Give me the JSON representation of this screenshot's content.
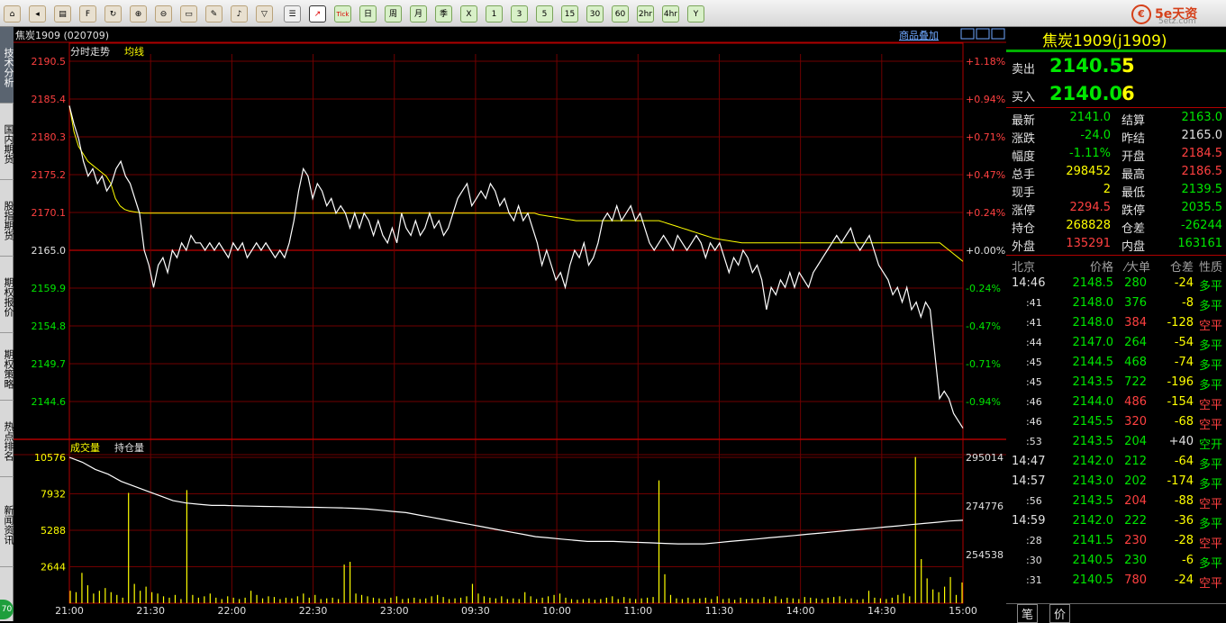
{
  "toolbar": {
    "buttons": [
      "home-icon",
      "back-icon",
      "save-icon",
      "f10",
      "refresh-icon",
      "zoom-in-icon",
      "zoom-out-icon",
      "window-icon",
      "draw-icon",
      "bell-icon",
      "filter-icon",
      "list-icon",
      "intraday-chart-icon",
      "Tick",
      "日",
      "周",
      "月",
      "季",
      "X",
      "1",
      "3",
      "5",
      "15",
      "30",
      "60",
      "2hr",
      "4hr",
      "Y"
    ]
  },
  "logo": {
    "text": "5e天资",
    "sub": "5etz.com"
  },
  "sidebar": {
    "tabs": [
      "技术分析",
      "国内期货",
      "股指期货",
      "期权报价",
      "期权策略",
      "热点排名",
      "新闻资讯"
    ],
    "corner": "70"
  },
  "chart_header": {
    "title": "焦炭1909 (020709)",
    "overlay_link": "商品叠加",
    "tab_intraday": "分时走势",
    "tab_avg": "均线",
    "vol_label": "成交量",
    "oi_label": "持仓量"
  },
  "chart_data": {
    "type": "line",
    "price_axis": {
      "ticks": [
        "2190.5",
        "2185.4",
        "2180.3",
        "2175.2",
        "2170.1",
        "2165.0",
        "2159.9",
        "2154.8",
        "2149.7",
        "2144.6"
      ],
      "pct": [
        "+1.18%",
        "+0.94%",
        "+0.71%",
        "+0.47%",
        "+0.24%",
        "+0.00%",
        "-0.24%",
        "-0.47%",
        "-0.71%",
        "-0.94%"
      ],
      "ylim": [
        2139.5,
        2190.5
      ],
      "prev_settle": 2165.0
    },
    "volume_axis": {
      "left": [
        "10576",
        "7932",
        "5288",
        "2644"
      ],
      "right": [
        "295014",
        "274776",
        "254538"
      ]
    },
    "x_ticks": [
      "21:00",
      "21:30",
      "22:00",
      "22:30",
      "23:00",
      "09:30",
      "10:00",
      "11:00",
      "11:30",
      "14:00",
      "14:30",
      "15:00"
    ],
    "price": [
      2184.5,
      2182,
      2180,
      2177,
      2175,
      2176,
      2174,
      2175,
      2173,
      2174,
      2176,
      2177,
      2175,
      2174,
      2172,
      2170,
      2165,
      2163,
      2160,
      2163,
      2164,
      2162,
      2165,
      2164,
      2166,
      2165,
      2167,
      2166,
      2166,
      2165,
      2166,
      2165,
      2166,
      2165,
      2164,
      2166,
      2165,
      2166,
      2164,
      2165,
      2166,
      2165,
      2166,
      2165,
      2164,
      2165,
      2164,
      2166,
      2169,
      2173,
      2176,
      2175,
      2172,
      2174,
      2173,
      2171,
      2172,
      2170,
      2171,
      2170,
      2168,
      2170,
      2168,
      2170,
      2169,
      2167,
      2169,
      2167,
      2166,
      2168,
      2166,
      2170,
      2168,
      2167,
      2169,
      2167,
      2168,
      2170,
      2168,
      2169,
      2167,
      2168,
      2170,
      2172,
      2173,
      2174,
      2171,
      2172,
      2173,
      2172,
      2174,
      2173,
      2171,
      2172,
      2170,
      2169,
      2171,
      2169,
      2170,
      2168,
      2166,
      2163,
      2165,
      2163,
      2161,
      2162,
      2160,
      2163,
      2165,
      2164,
      2166,
      2163,
      2164,
      2166,
      2169,
      2170,
      2169,
      2171,
      2169,
      2170,
      2171,
      2169,
      2170,
      2168,
      2166,
      2165,
      2166,
      2167,
      2166,
      2165,
      2167,
      2166,
      2165,
      2166,
      2167,
      2166,
      2164,
      2166,
      2165,
      2166,
      2164,
      2162,
      2164,
      2163,
      2165,
      2164,
      2162,
      2163,
      2161,
      2157,
      2160,
      2159,
      2161,
      2160,
      2162,
      2160,
      2162,
      2161,
      2160,
      2162,
      2163,
      2164,
      2165,
      2166,
      2167,
      2166,
      2167,
      2168,
      2166,
      2165,
      2166,
      2167,
      2165,
      2163,
      2162,
      2161,
      2159,
      2160,
      2158,
      2160,
      2157,
      2158,
      2156,
      2158,
      2157,
      2151,
      2145,
      2146,
      2145,
      2143,
      2142,
      2141
    ],
    "avg": [
      2184.5,
      2181,
      2179,
      2178,
      2177,
      2176.5,
      2176,
      2175.5,
      2175,
      2174,
      2172,
      2171,
      2170.5,
      2170.3,
      2170.2,
      2170.1,
      2170,
      2170,
      2170,
      2170,
      2170,
      2170,
      2170,
      2170,
      2170,
      2170,
      2170,
      2170,
      2170,
      2170,
      2170,
      2170,
      2170,
      2170,
      2170,
      2170,
      2170,
      2170,
      2170,
      2170,
      2170,
      2170,
      2170,
      2170,
      2170,
      2170,
      2170,
      2170,
      2170,
      2170,
      2170,
      2170,
      2170,
      2170,
      2170,
      2170,
      2170,
      2170,
      2170,
      2170,
      2170,
      2170,
      2170,
      2170,
      2170,
      2170,
      2170,
      2170,
      2170,
      2170,
      2170,
      2170,
      2170,
      2170,
      2170,
      2170,
      2170,
      2170,
      2170,
      2170,
      2170,
      2170,
      2170,
      2170,
      2170,
      2170,
      2170,
      2170,
      2170,
      2170,
      2170,
      2170,
      2170,
      2170,
      2170,
      2170,
      2170,
      2170,
      2170,
      2170,
      2170,
      2170,
      2169.8,
      2169.7,
      2169.6,
      2169.5,
      2169.4,
      2169.3,
      2169.2,
      2169.1,
      2169,
      2169,
      2169,
      2169,
      2169,
      2169,
      2169,
      2169,
      2169,
      2169,
      2169,
      2169,
      2169,
      2169,
      2169,
      2169,
      2169,
      2169,
      2169,
      2168.8,
      2168.6,
      2168.4,
      2168.2,
      2168,
      2167.8,
      2167.6,
      2167.4,
      2167.2,
      2167,
      2166.8,
      2166.6,
      2166.5,
      2166.4,
      2166.3,
      2166.2,
      2166.1,
      2166,
      2166,
      2166,
      2166,
      2166,
      2166,
      2166,
      2166,
      2166,
      2166,
      2166,
      2166,
      2166,
      2166,
      2166,
      2166,
      2166,
      2166,
      2166,
      2166,
      2166,
      2166,
      2166,
      2166,
      2166,
      2166,
      2166,
      2166,
      2166,
      2166,
      2166,
      2166,
      2166,
      2166,
      2166,
      2166,
      2166,
      2166,
      2166,
      2166,
      2166,
      2166,
      2166,
      2166,
      2165.5,
      2165,
      2164.5,
      2164,
      2163.5
    ],
    "open_interest": [
      295014,
      293000,
      290000,
      288000,
      285000,
      283000,
      281000,
      279000,
      277000,
      276000,
      275500,
      275000,
      275000,
      274800,
      274700,
      274600,
      274500,
      274400,
      274300,
      274200,
      274100,
      274000,
      273800,
      273500,
      273000,
      272500,
      272000,
      271000,
      270000,
      269000,
      268000,
      267000,
      266000,
      265000,
      264000,
      263000,
      262000,
      261500,
      261000,
      260500,
      260000,
      260000,
      260000,
      259800,
      259600,
      259400,
      259200,
      259000,
      259000,
      259000,
      259500,
      260000,
      260500,
      261000,
      261500,
      262000,
      262500,
      263000,
      263500,
      264000,
      264500,
      265000,
      265500,
      266000,
      266500,
      267000,
      267500,
      268000,
      268500,
      268828
    ],
    "volume": [
      900,
      800,
      2200,
      1300,
      700,
      900,
      1100,
      800,
      600,
      400,
      8000,
      1400,
      900,
      1200,
      800,
      700,
      500,
      400,
      600,
      300,
      8200,
      600,
      400,
      500,
      700,
      400,
      300,
      500,
      400,
      300,
      400,
      900,
      600,
      350,
      500,
      450,
      300,
      400,
      350,
      500,
      700,
      400,
      600,
      300,
      350,
      400,
      300,
      2800,
      3000,
      700,
      600,
      500,
      400,
      350,
      300,
      400,
      500,
      300,
      350,
      400,
      300,
      350,
      500,
      600,
      450,
      300,
      350,
      400,
      500,
      1400,
      700,
      500,
      400,
      350,
      500,
      300,
      350,
      300,
      800,
      500,
      300,
      400,
      500,
      600,
      700,
      400,
      300,
      250,
      300,
      350,
      250,
      300,
      400,
      500,
      300,
      450,
      350,
      300,
      350,
      400,
      450,
      8900,
      2100,
      600,
      350,
      300,
      400,
      300,
      350,
      400,
      300,
      500,
      300,
      350,
      250,
      400,
      300,
      350,
      300,
      450,
      300,
      500,
      300,
      400,
      350,
      300,
      450,
      400,
      350,
      300,
      400,
      450,
      500,
      300,
      350,
      250,
      300,
      900,
      400,
      350,
      300,
      400,
      600,
      700,
      500,
      10600,
      3200,
      1800,
      1000,
      800,
      1200,
      1900,
      600,
      1500
    ]
  },
  "quote": {
    "sell_label": "卖出",
    "sell_price": "2140.5",
    "sell_vol": "5",
    "buy_label": "买入",
    "buy_price": "2140.0",
    "buy_vol": "6",
    "stats": [
      [
        "最新",
        "2141.0",
        "结算",
        "2163.0"
      ],
      [
        "涨跌",
        "-24.0",
        "昨结",
        "2165.0"
      ],
      [
        "幅度",
        "-1.11%",
        "开盘",
        "2184.5"
      ],
      [
        "总手",
        "298452",
        "最高",
        "2186.5"
      ],
      [
        "现手",
        "2",
        "最低",
        "2139.5"
      ],
      [
        "涨停",
        "2294.5",
        "跌停",
        "2035.5"
      ],
      [
        "持仓",
        "268828",
        "仓差",
        "-26244"
      ],
      [
        "外盘",
        "135291",
        "内盘",
        "163161"
      ]
    ],
    "stat_colors": [
      [
        "g",
        "g"
      ],
      [
        "g",
        "w"
      ],
      [
        "g",
        "r"
      ],
      [
        "y",
        "r"
      ],
      [
        "y",
        "g"
      ],
      [
        "r",
        "g"
      ],
      [
        "y",
        "g"
      ],
      [
        "r",
        "g"
      ]
    ]
  },
  "ticks_header": [
    "北京",
    "价格",
    "⁄大单",
    "仓差",
    "性质"
  ],
  "ticks": [
    [
      "14:46",
      "2148.5",
      "280",
      "-24",
      "多平"
    ],
    [
      ":41",
      "2148.0",
      "376",
      "-8",
      "多平"
    ],
    [
      ":41",
      "2148.0",
      "384",
      "-128",
      "空平"
    ],
    [
      ":44",
      "2147.0",
      "264",
      "-54",
      "多平"
    ],
    [
      ":45",
      "2144.5",
      "468",
      "-74",
      "多平"
    ],
    [
      ":45",
      "2143.5",
      "722",
      "-196",
      "多平"
    ],
    [
      ":46",
      "2144.0",
      "486",
      "-154",
      "空平"
    ],
    [
      ":46",
      "2145.5",
      "320",
      "-68",
      "空平"
    ],
    [
      ":53",
      "2143.5",
      "204",
      "+40",
      "空开"
    ],
    [
      "14:47",
      "2142.0",
      "212",
      "-64",
      "多平"
    ],
    [
      "14:57",
      "2143.0",
      "202",
      "-174",
      "多平"
    ],
    [
      ":56",
      "2143.5",
      "204",
      "-88",
      "空平"
    ],
    [
      "14:59",
      "2142.0",
      "222",
      "-36",
      "多平"
    ],
    [
      ":28",
      "2141.5",
      "230",
      "-28",
      "空平"
    ],
    [
      ":30",
      "2140.5",
      "230",
      "-6",
      "多平"
    ],
    [
      ":31",
      "2140.5",
      "780",
      "-24",
      "空平"
    ]
  ],
  "tick_colors": [
    "g",
    "g",
    "r",
    "g",
    "g",
    "g",
    "r",
    "r",
    "g",
    "g",
    "g",
    "r",
    "g",
    "r",
    "g",
    "r"
  ],
  "bottom_tabs": [
    "笔",
    "价"
  ]
}
